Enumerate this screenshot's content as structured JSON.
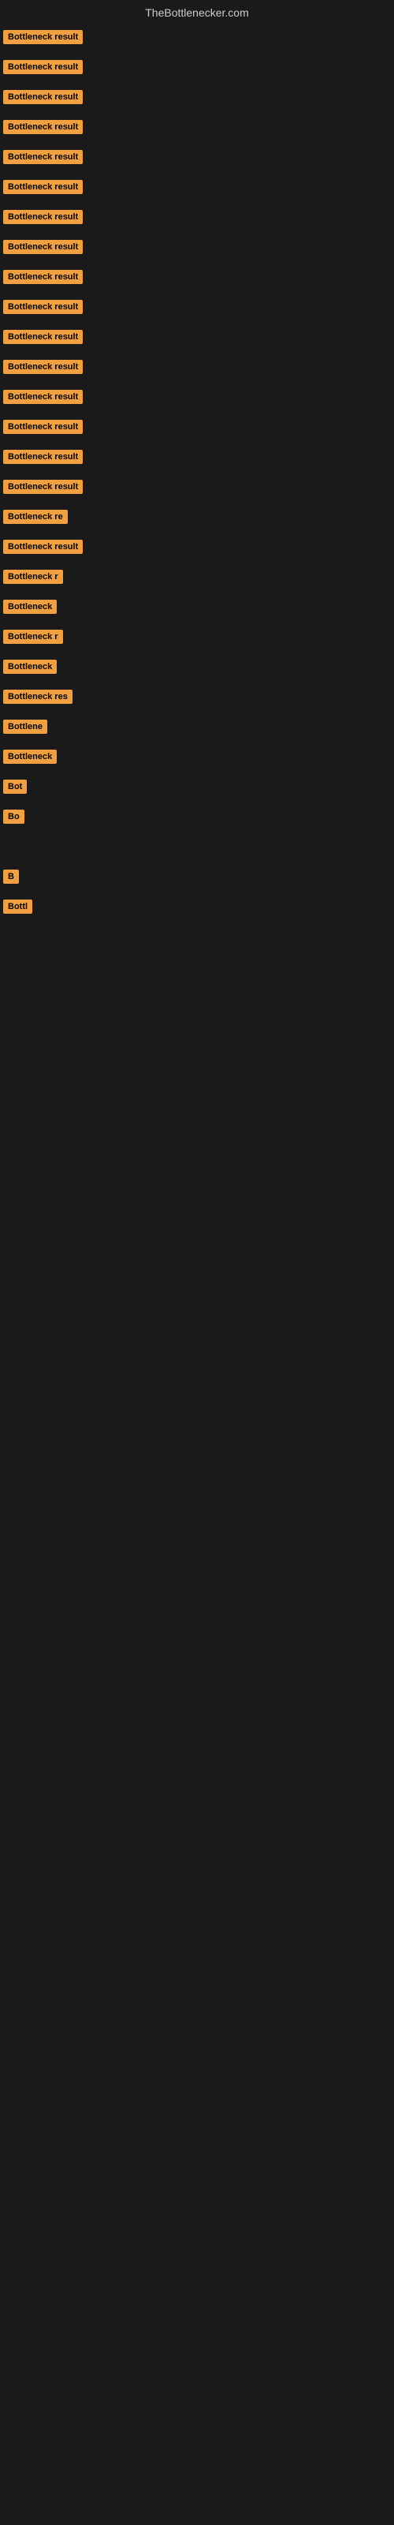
{
  "header": {
    "title": "TheBottlenecker.com"
  },
  "items": [
    {
      "id": 1,
      "label": "Bottleneck result",
      "width": 120
    },
    {
      "id": 2,
      "label": "Bottleneck result",
      "width": 120
    },
    {
      "id": 3,
      "label": "Bottleneck result",
      "width": 120
    },
    {
      "id": 4,
      "label": "Bottleneck result",
      "width": 120
    },
    {
      "id": 5,
      "label": "Bottleneck result",
      "width": 120
    },
    {
      "id": 6,
      "label": "Bottleneck result",
      "width": 115
    },
    {
      "id": 7,
      "label": "Bottleneck result",
      "width": 115
    },
    {
      "id": 8,
      "label": "Bottleneck result",
      "width": 112
    },
    {
      "id": 9,
      "label": "Bottleneck result",
      "width": 112
    },
    {
      "id": 10,
      "label": "Bottleneck result",
      "width": 110
    },
    {
      "id": 11,
      "label": "Bottleneck result",
      "width": 110
    },
    {
      "id": 12,
      "label": "Bottleneck result",
      "width": 108
    },
    {
      "id": 13,
      "label": "Bottleneck result",
      "width": 105
    },
    {
      "id": 14,
      "label": "Bottleneck result",
      "width": 105
    },
    {
      "id": 15,
      "label": "Bottleneck result",
      "width": 100
    },
    {
      "id": 16,
      "label": "Bottleneck result",
      "width": 98
    },
    {
      "id": 17,
      "label": "Bottleneck re",
      "width": 88
    },
    {
      "id": 18,
      "label": "Bottleneck result",
      "width": 95
    },
    {
      "id": 19,
      "label": "Bottleneck r",
      "width": 80
    },
    {
      "id": 20,
      "label": "Bottleneck",
      "width": 72
    },
    {
      "id": 21,
      "label": "Bottleneck r",
      "width": 80
    },
    {
      "id": 22,
      "label": "Bottleneck",
      "width": 72
    },
    {
      "id": 23,
      "label": "Bottleneck res",
      "width": 88
    },
    {
      "id": 24,
      "label": "Bottlene",
      "width": 65
    },
    {
      "id": 25,
      "label": "Bottleneck",
      "width": 72
    },
    {
      "id": 26,
      "label": "Bot",
      "width": 38
    },
    {
      "id": 27,
      "label": "Bo",
      "width": 30
    },
    {
      "id": 28,
      "label": "",
      "width": 0
    },
    {
      "id": 29,
      "label": "B",
      "width": 14
    },
    {
      "id": 30,
      "label": "Bottl",
      "width": 40
    },
    {
      "id": 31,
      "label": "",
      "width": 0
    }
  ]
}
